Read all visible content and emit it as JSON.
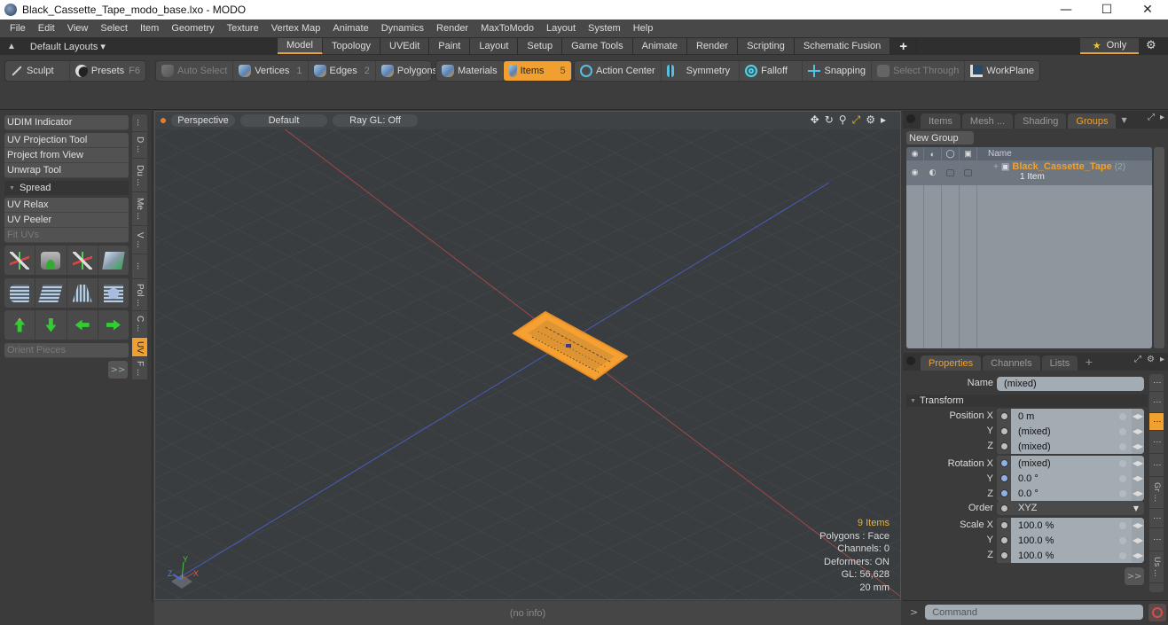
{
  "window": {
    "title": "Black_Cassette_Tape_modo_base.lxo - MODO",
    "controls": [
      "minimize",
      "maximize",
      "close"
    ]
  },
  "menubar": [
    "File",
    "Edit",
    "View",
    "Select",
    "Item",
    "Geometry",
    "Texture",
    "Vertex Map",
    "Animate",
    "Dynamics",
    "Render",
    "MaxToModo",
    "Layout",
    "System",
    "Help"
  ],
  "layoutbar": {
    "layouts_label": "Default Layouts ▾",
    "tabs": [
      {
        "label": "Model",
        "active": true
      },
      {
        "label": "Topology",
        "active": false
      },
      {
        "label": "UVEdit",
        "active": false
      },
      {
        "label": "Paint",
        "active": false
      },
      {
        "label": "Layout",
        "active": false
      },
      {
        "label": "Setup",
        "active": false
      },
      {
        "label": "Game Tools",
        "active": false
      },
      {
        "label": "Animate",
        "active": false
      },
      {
        "label": "Render",
        "active": false
      },
      {
        "label": "Scripting",
        "active": false
      },
      {
        "label": "Schematic Fusion",
        "active": false
      }
    ],
    "add_tab": "+",
    "only_label": "Only"
  },
  "toolbar": {
    "sculpt": "Sculpt",
    "presets": "Presets",
    "presets_key": "F6",
    "auto_select": "Auto Select",
    "vertices": "Vertices",
    "vertices_key": "1",
    "edges": "Edges",
    "edges_key": "2",
    "polygons": "Polygons",
    "materials": "Materials",
    "items": "Items",
    "items_key": "5",
    "action_center": "Action Center",
    "symmetry": "Symmetry",
    "falloff": "Falloff",
    "snapping": "Snapping",
    "select_through": "Select Through",
    "workplane": "WorkPlane"
  },
  "leftpanel": {
    "udim": "UDIM Indicator",
    "uv_projection": "UV Projection Tool",
    "project_from_view": "Project from View",
    "unwrap": "Unwrap Tool",
    "spread": "Spread",
    "uv_relax": "UV Relax",
    "uv_peeler": "UV Peeler",
    "fit_uvs": "Fit UVs",
    "orient_pieces": "Orient Pieces",
    "more": ">>",
    "vtabs": [
      {
        "label": "...",
        "active": false
      },
      {
        "label": "D ...",
        "active": false
      },
      {
        "label": "Du ...",
        "active": false
      },
      {
        "label": "Me ...",
        "active": false
      },
      {
        "label": "V ...",
        "active": false
      },
      {
        "label": "...",
        "active": false
      },
      {
        "label": "Pol ...",
        "active": false
      },
      {
        "label": "C ...",
        "active": false
      },
      {
        "label": "UV",
        "active": true
      },
      {
        "label": "F ...",
        "active": false
      }
    ]
  },
  "viewport": {
    "view": "Perspective",
    "shading": "Default",
    "raygl": "Ray GL: Off",
    "info": {
      "items": "9 Items",
      "polygons": "Polygons : Face",
      "channels": "Channels: 0",
      "deformers": "Deformers: ON",
      "gl": "GL: 56,628",
      "scale": "20 mm"
    },
    "axis_labels": {
      "x": "X",
      "y": "Y",
      "z": "Z"
    },
    "colors": {
      "x_axis": "#b05050",
      "z_axis": "#4a5cb8",
      "selection": "#f5a030"
    }
  },
  "statusbar": {
    "text": "(no info)"
  },
  "groups_panel": {
    "tabs": [
      {
        "label": "Items",
        "active": false
      },
      {
        "label": "Mesh ...",
        "active": false
      },
      {
        "label": "Shading",
        "active": false
      },
      {
        "label": "Groups",
        "active": true
      }
    ],
    "new_group": "New Group",
    "columns": [
      "eye",
      "render",
      "lock",
      "select",
      "Name"
    ],
    "rows": [
      {
        "name": "Black_Cassette_Tape",
        "count": "(2)",
        "sub": "1 Item"
      }
    ]
  },
  "properties_panel": {
    "tabs": [
      {
        "label": "Properties",
        "active": true
      },
      {
        "label": "Channels",
        "active": false
      },
      {
        "label": "Lists",
        "active": false
      }
    ],
    "add_tab": "+",
    "name_label": "Name",
    "name_value": "(mixed)",
    "section": "Transform",
    "position": [
      {
        "label": "Position X",
        "value": "0 m"
      },
      {
        "label": "Y",
        "value": "(mixed)"
      },
      {
        "label": "Z",
        "value": "(mixed)"
      }
    ],
    "rotation": [
      {
        "label": "Rotation X",
        "value": "(mixed)"
      },
      {
        "label": "Y",
        "value": "0.0 °"
      },
      {
        "label": "Z",
        "value": "0.0 °"
      }
    ],
    "order_label": "Order",
    "order_value": "XYZ",
    "scale": [
      {
        "label": "Scale X",
        "value": "100.0 %"
      },
      {
        "label": "Y",
        "value": "100.0 %"
      },
      {
        "label": "Z",
        "value": "100.0 %"
      }
    ],
    "more": ">>",
    "vtabs": [
      {
        "label": "⋮",
        "active": false
      },
      {
        "label": "⋮",
        "active": false
      },
      {
        "label": "⋮",
        "active": true
      },
      {
        "label": "⋮",
        "active": false
      },
      {
        "label": "⋮",
        "active": false
      },
      {
        "label": "Gr ...",
        "active": false
      },
      {
        "label": "⋮",
        "active": false
      },
      {
        "label": "⋮",
        "active": false
      },
      {
        "label": "Us ...",
        "active": false
      }
    ]
  },
  "command": {
    "prompt": ">",
    "placeholder": "Command"
  }
}
